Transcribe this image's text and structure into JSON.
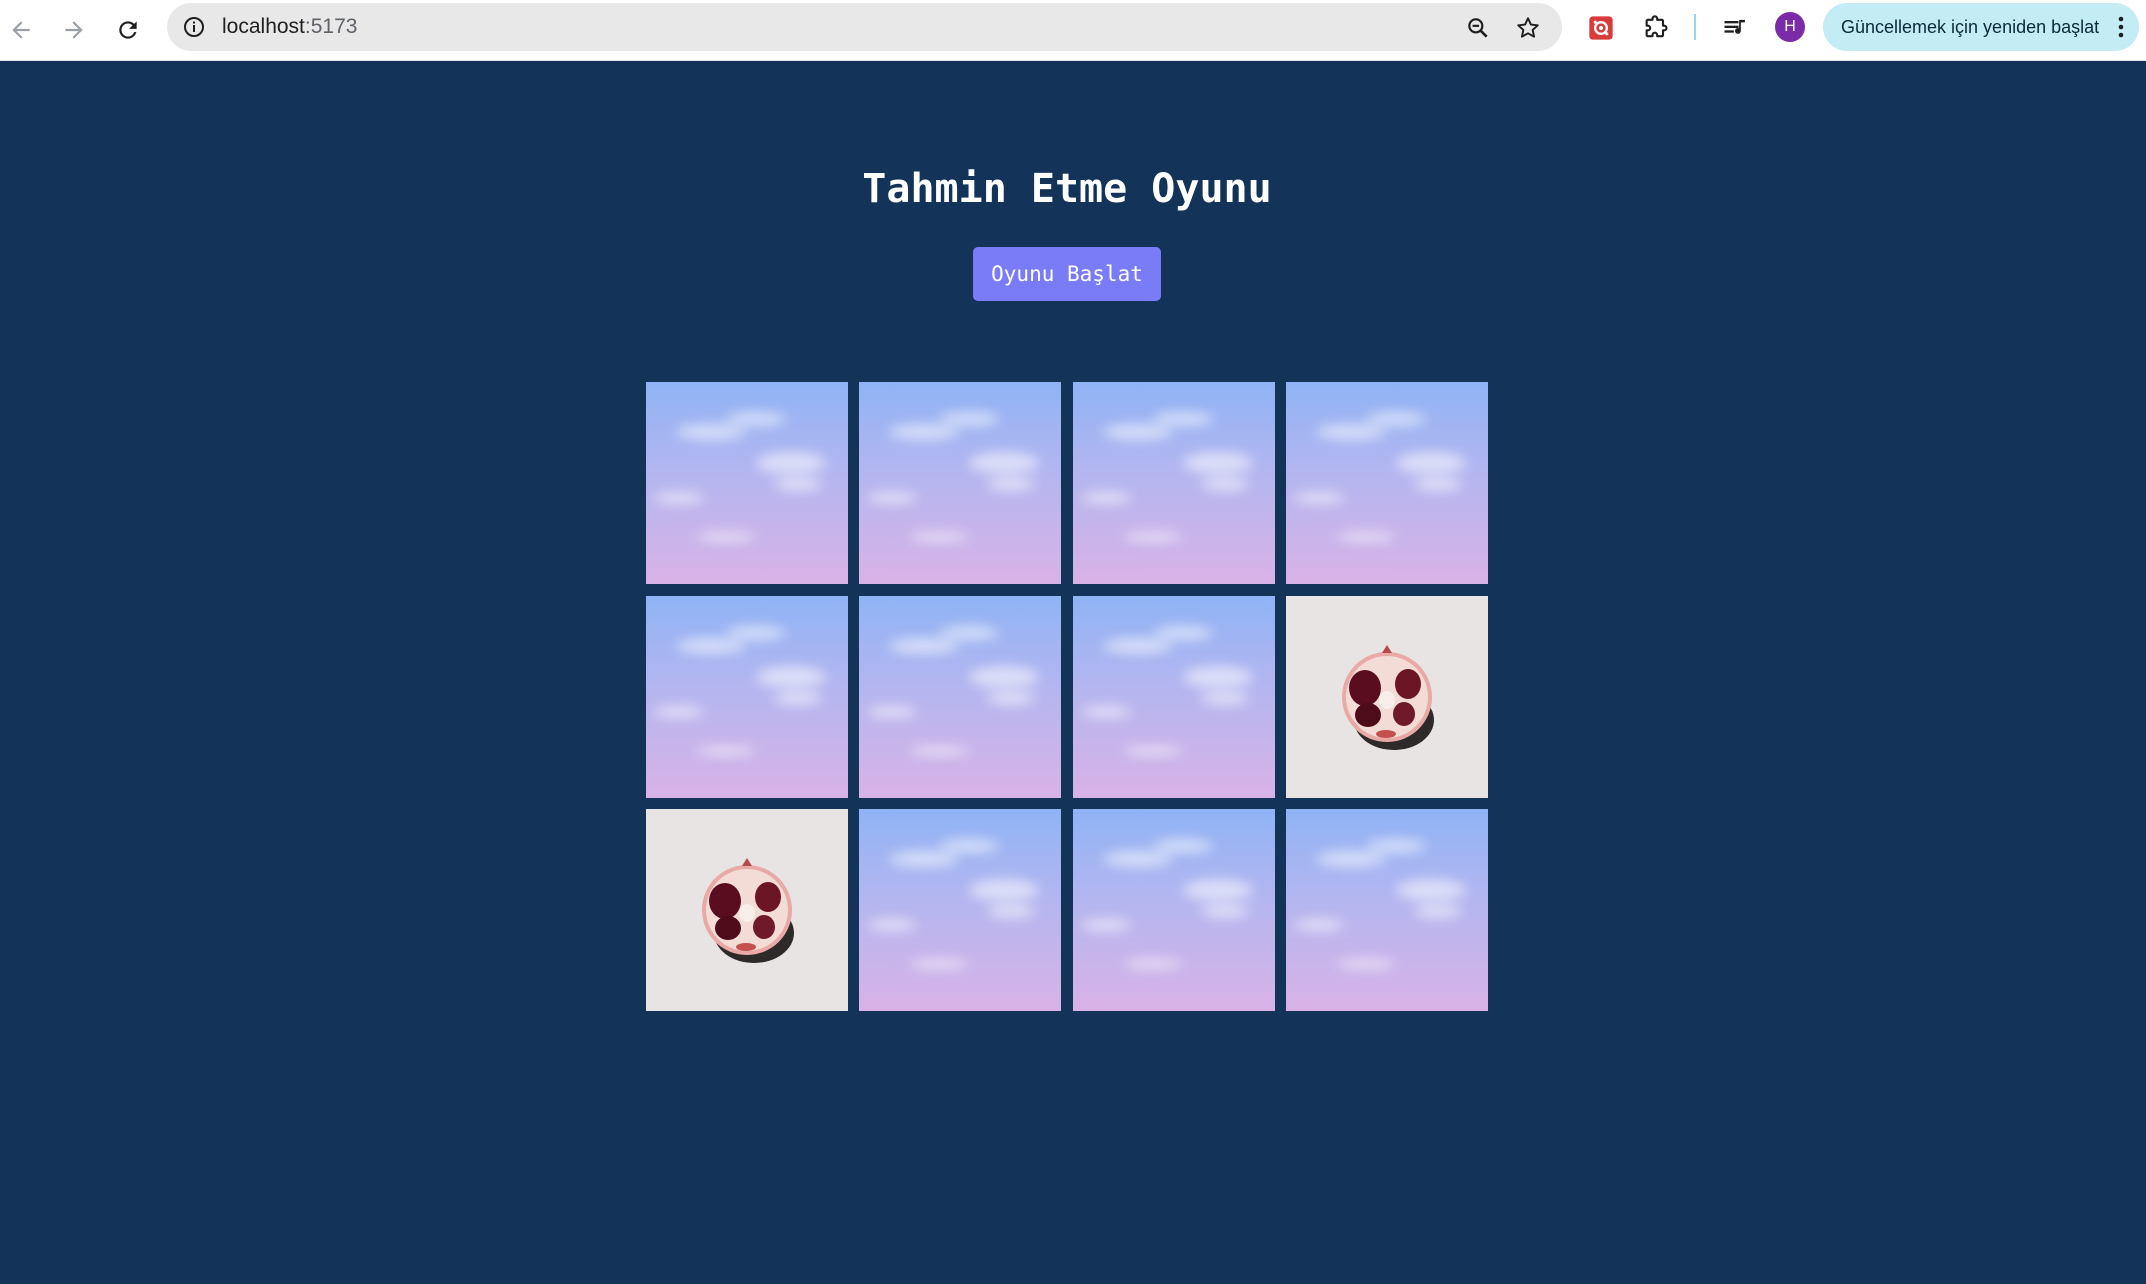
{
  "browser": {
    "url_host": "localhost",
    "url_port": ":5173",
    "update_label": "Güncellemek için yeniden başlat",
    "avatar_initial": "H"
  },
  "game": {
    "title": "Tahmin Etme Oyunu",
    "start_button": "Oyunu Başlat",
    "rows": 3,
    "columns": 4,
    "cards": [
      {
        "state": "face-down"
      },
      {
        "state": "face-down"
      },
      {
        "state": "face-down"
      },
      {
        "state": "face-down"
      },
      {
        "state": "face-down"
      },
      {
        "state": "face-down"
      },
      {
        "state": "face-down"
      },
      {
        "state": "face-up",
        "image": "pomegranate"
      },
      {
        "state": "face-up",
        "image": "pomegranate"
      },
      {
        "state": "face-down"
      },
      {
        "state": "face-down"
      },
      {
        "state": "face-down"
      }
    ]
  },
  "colors": {
    "page_background": "#133359",
    "button": "#7a7cf7",
    "card_back_top": "#8fb3f5",
    "card_back_bottom": "#d8b2e6",
    "card_front": "#e7e4e3"
  }
}
